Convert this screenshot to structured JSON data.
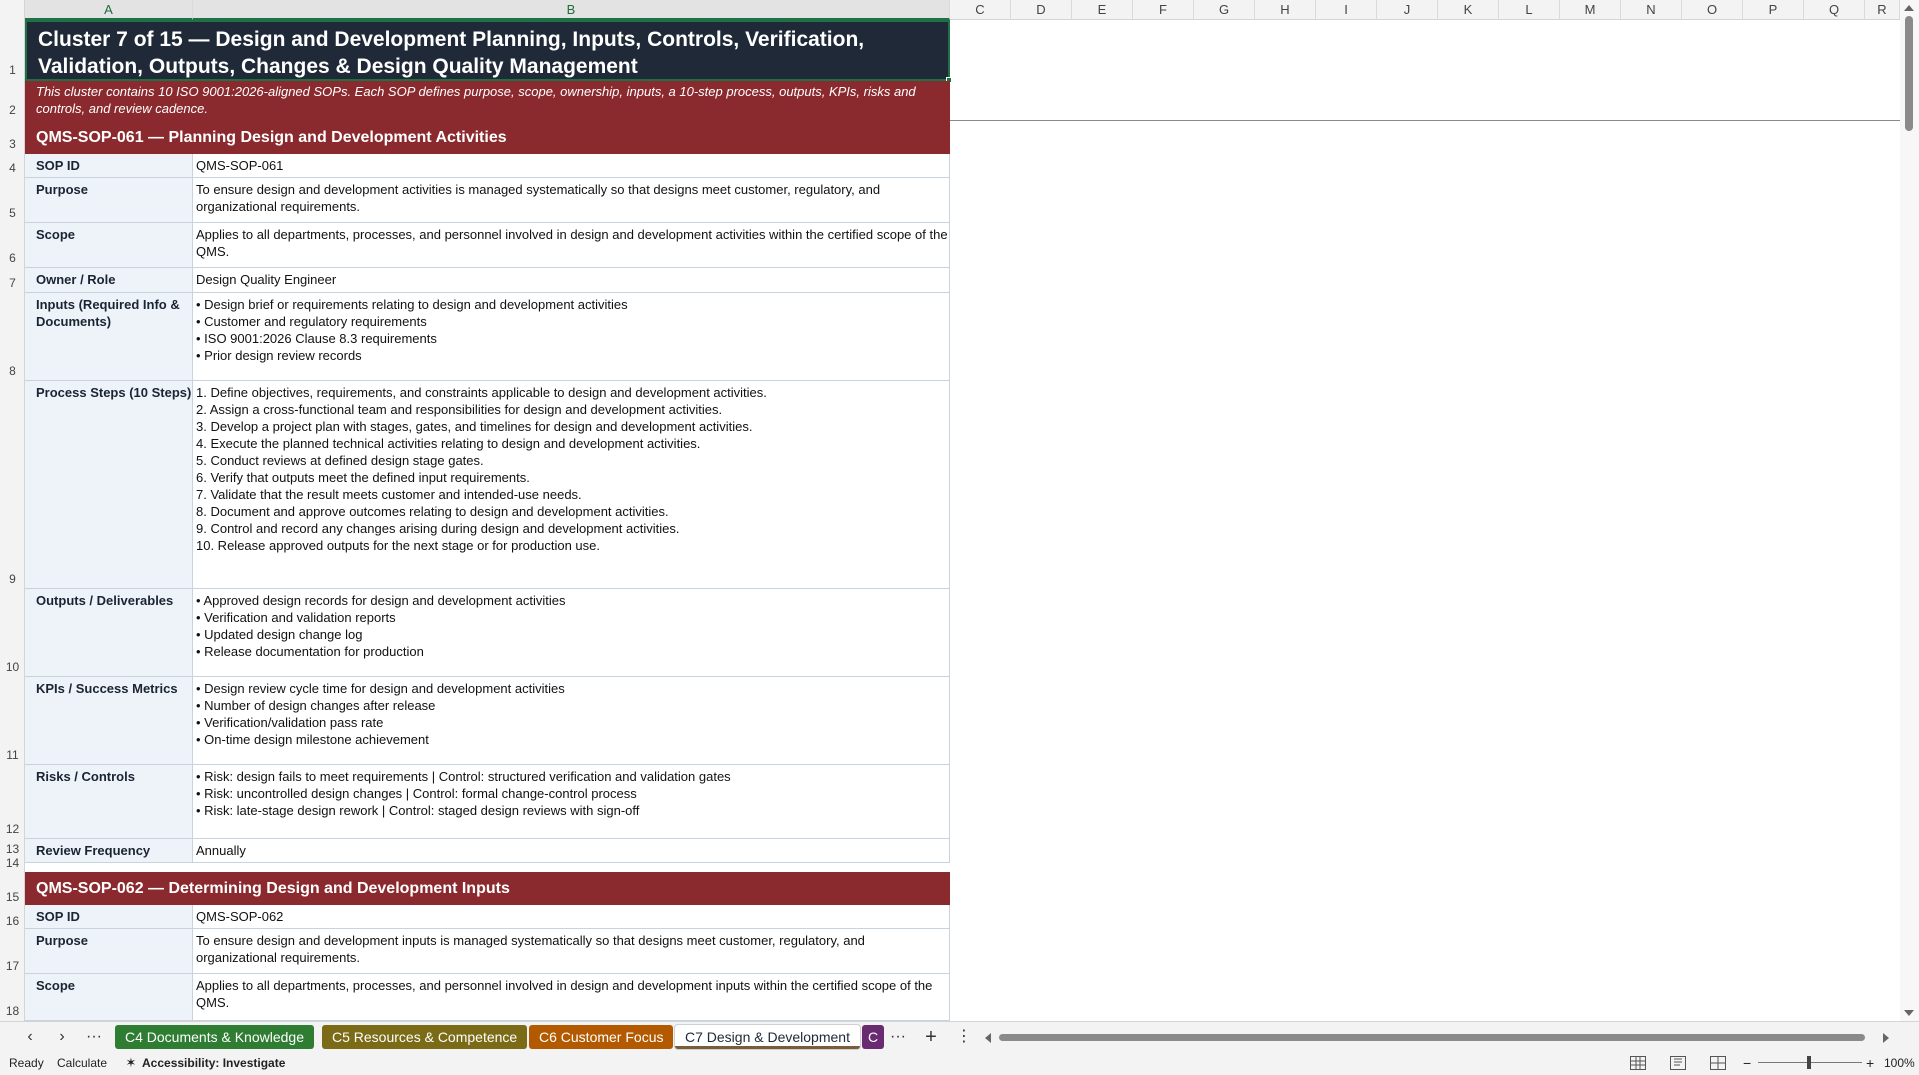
{
  "columns": [
    "A",
    "B",
    "C",
    "D",
    "E",
    "F",
    "G",
    "H",
    "I",
    "J",
    "K",
    "L",
    "M",
    "N",
    "O",
    "P",
    "Q",
    "R"
  ],
  "rows": [
    "1",
    "2",
    "3",
    "4",
    "5",
    "6",
    "7",
    "8",
    "9",
    "10",
    "11",
    "12",
    "13",
    "14",
    "15",
    "16",
    "17",
    "18"
  ],
  "title": "Cluster 7 of 15  —  Design and Development Planning, Inputs, Controls, Verification, Validation, Outputs, Changes & Design Quality Management",
  "subtitle": "This cluster contains 10 ISO 9001:2026-aligned SOPs. Each SOP defines purpose, scope, ownership, inputs, a 10-step process, outputs, KPIs, risks and controls, and review cadence.",
  "sop1": {
    "header": "QMS-SOP-061  —  Planning Design and Development Activities",
    "fields": [
      {
        "label": "SOP ID",
        "value": "QMS-SOP-061"
      },
      {
        "label": "Purpose",
        "value": "To ensure design and development activities is managed systematically so that designs meet customer, regulatory, and organizational requirements."
      },
      {
        "label": "Scope",
        "value": "Applies to all departments, processes, and personnel involved in design and development activities within the certified scope of the QMS."
      },
      {
        "label": "Owner / Role",
        "value": "Design Quality Engineer"
      },
      {
        "label": "Inputs (Required Info & Documents)",
        "value": "• Design brief or requirements relating to design and development activities\n• Customer and regulatory requirements\n• ISO 9001:2026 Clause 8.3 requirements\n• Prior design review records"
      },
      {
        "label": "Process Steps (10 Steps)",
        "value": "1. Define objectives, requirements, and constraints applicable to design and development activities.\n2. Assign a cross-functional team and responsibilities for design and development activities.\n3. Develop a project plan with stages, gates, and timelines for design and development activities.\n4. Execute the planned technical activities relating to design and development activities.\n5. Conduct reviews at defined design stage gates.\n6. Verify that outputs meet the defined input requirements.\n7. Validate that the result meets customer and intended-use needs.\n8. Document and approve outcomes relating to design and development activities.\n9. Control and record any changes arising during design and development activities.\n10. Release approved outputs for the next stage or for production use."
      },
      {
        "label": "Outputs / Deliverables",
        "value": "• Approved design records for design and development activities\n• Verification and validation reports\n• Updated design change log\n• Release documentation for production"
      },
      {
        "label": "KPIs / Success Metrics",
        "value": "• Design review cycle time for design and development activities\n• Number of design changes after release\n• Verification/validation pass rate\n• On-time design milestone achievement"
      },
      {
        "label": "Risks / Controls",
        "value": "• Risk: design fails to meet requirements | Control: structured verification and validation gates\n• Risk: uncontrolled design changes | Control: formal change-control process\n• Risk: late-stage design rework | Control: staged design reviews with sign-off"
      },
      {
        "label": "Review Frequency",
        "value": "Annually"
      }
    ]
  },
  "sop2": {
    "header": "QMS-SOP-062  —  Determining Design and Development Inputs",
    "fields": [
      {
        "label": "SOP ID",
        "value": "QMS-SOP-062"
      },
      {
        "label": "Purpose",
        "value": "To ensure design and development inputs is managed systematically so that designs meet customer, regulatory, and organizational requirements."
      },
      {
        "label": "Scope",
        "value": "Applies to all departments, processes, and personnel involved in design and development inputs within the certified scope of the QMS."
      }
    ]
  },
  "sheet_tabs": [
    {
      "label": "C4 Documents & Knowledge",
      "color": "#2e7d32"
    },
    {
      "label": "C5 Resources & Competence",
      "color": "#7b6a16"
    },
    {
      "label": "C6 Customer Focus",
      "color": "#b35a00"
    },
    {
      "label": "C7 Design & Development",
      "color": "#7a5b3a"
    },
    {
      "label": "C",
      "color": "#6a2c70"
    }
  ],
  "tab_controls": {
    "prev": "‹",
    "next": "›",
    "more_left": "···",
    "more_right": "···",
    "add": "+",
    "options": "⋮"
  },
  "status": {
    "ready": "Ready",
    "calculate": "Calculate",
    "accessibility": "Accessibility: Investigate",
    "zoom_minus": "−",
    "zoom_plus": "+",
    "zoom": "100%"
  },
  "icons": {
    "accessibility": "accessibility-icon",
    "normal_view": "normal-view-icon",
    "page_layout": "page-layout-icon",
    "page_break": "page-break-icon"
  }
}
